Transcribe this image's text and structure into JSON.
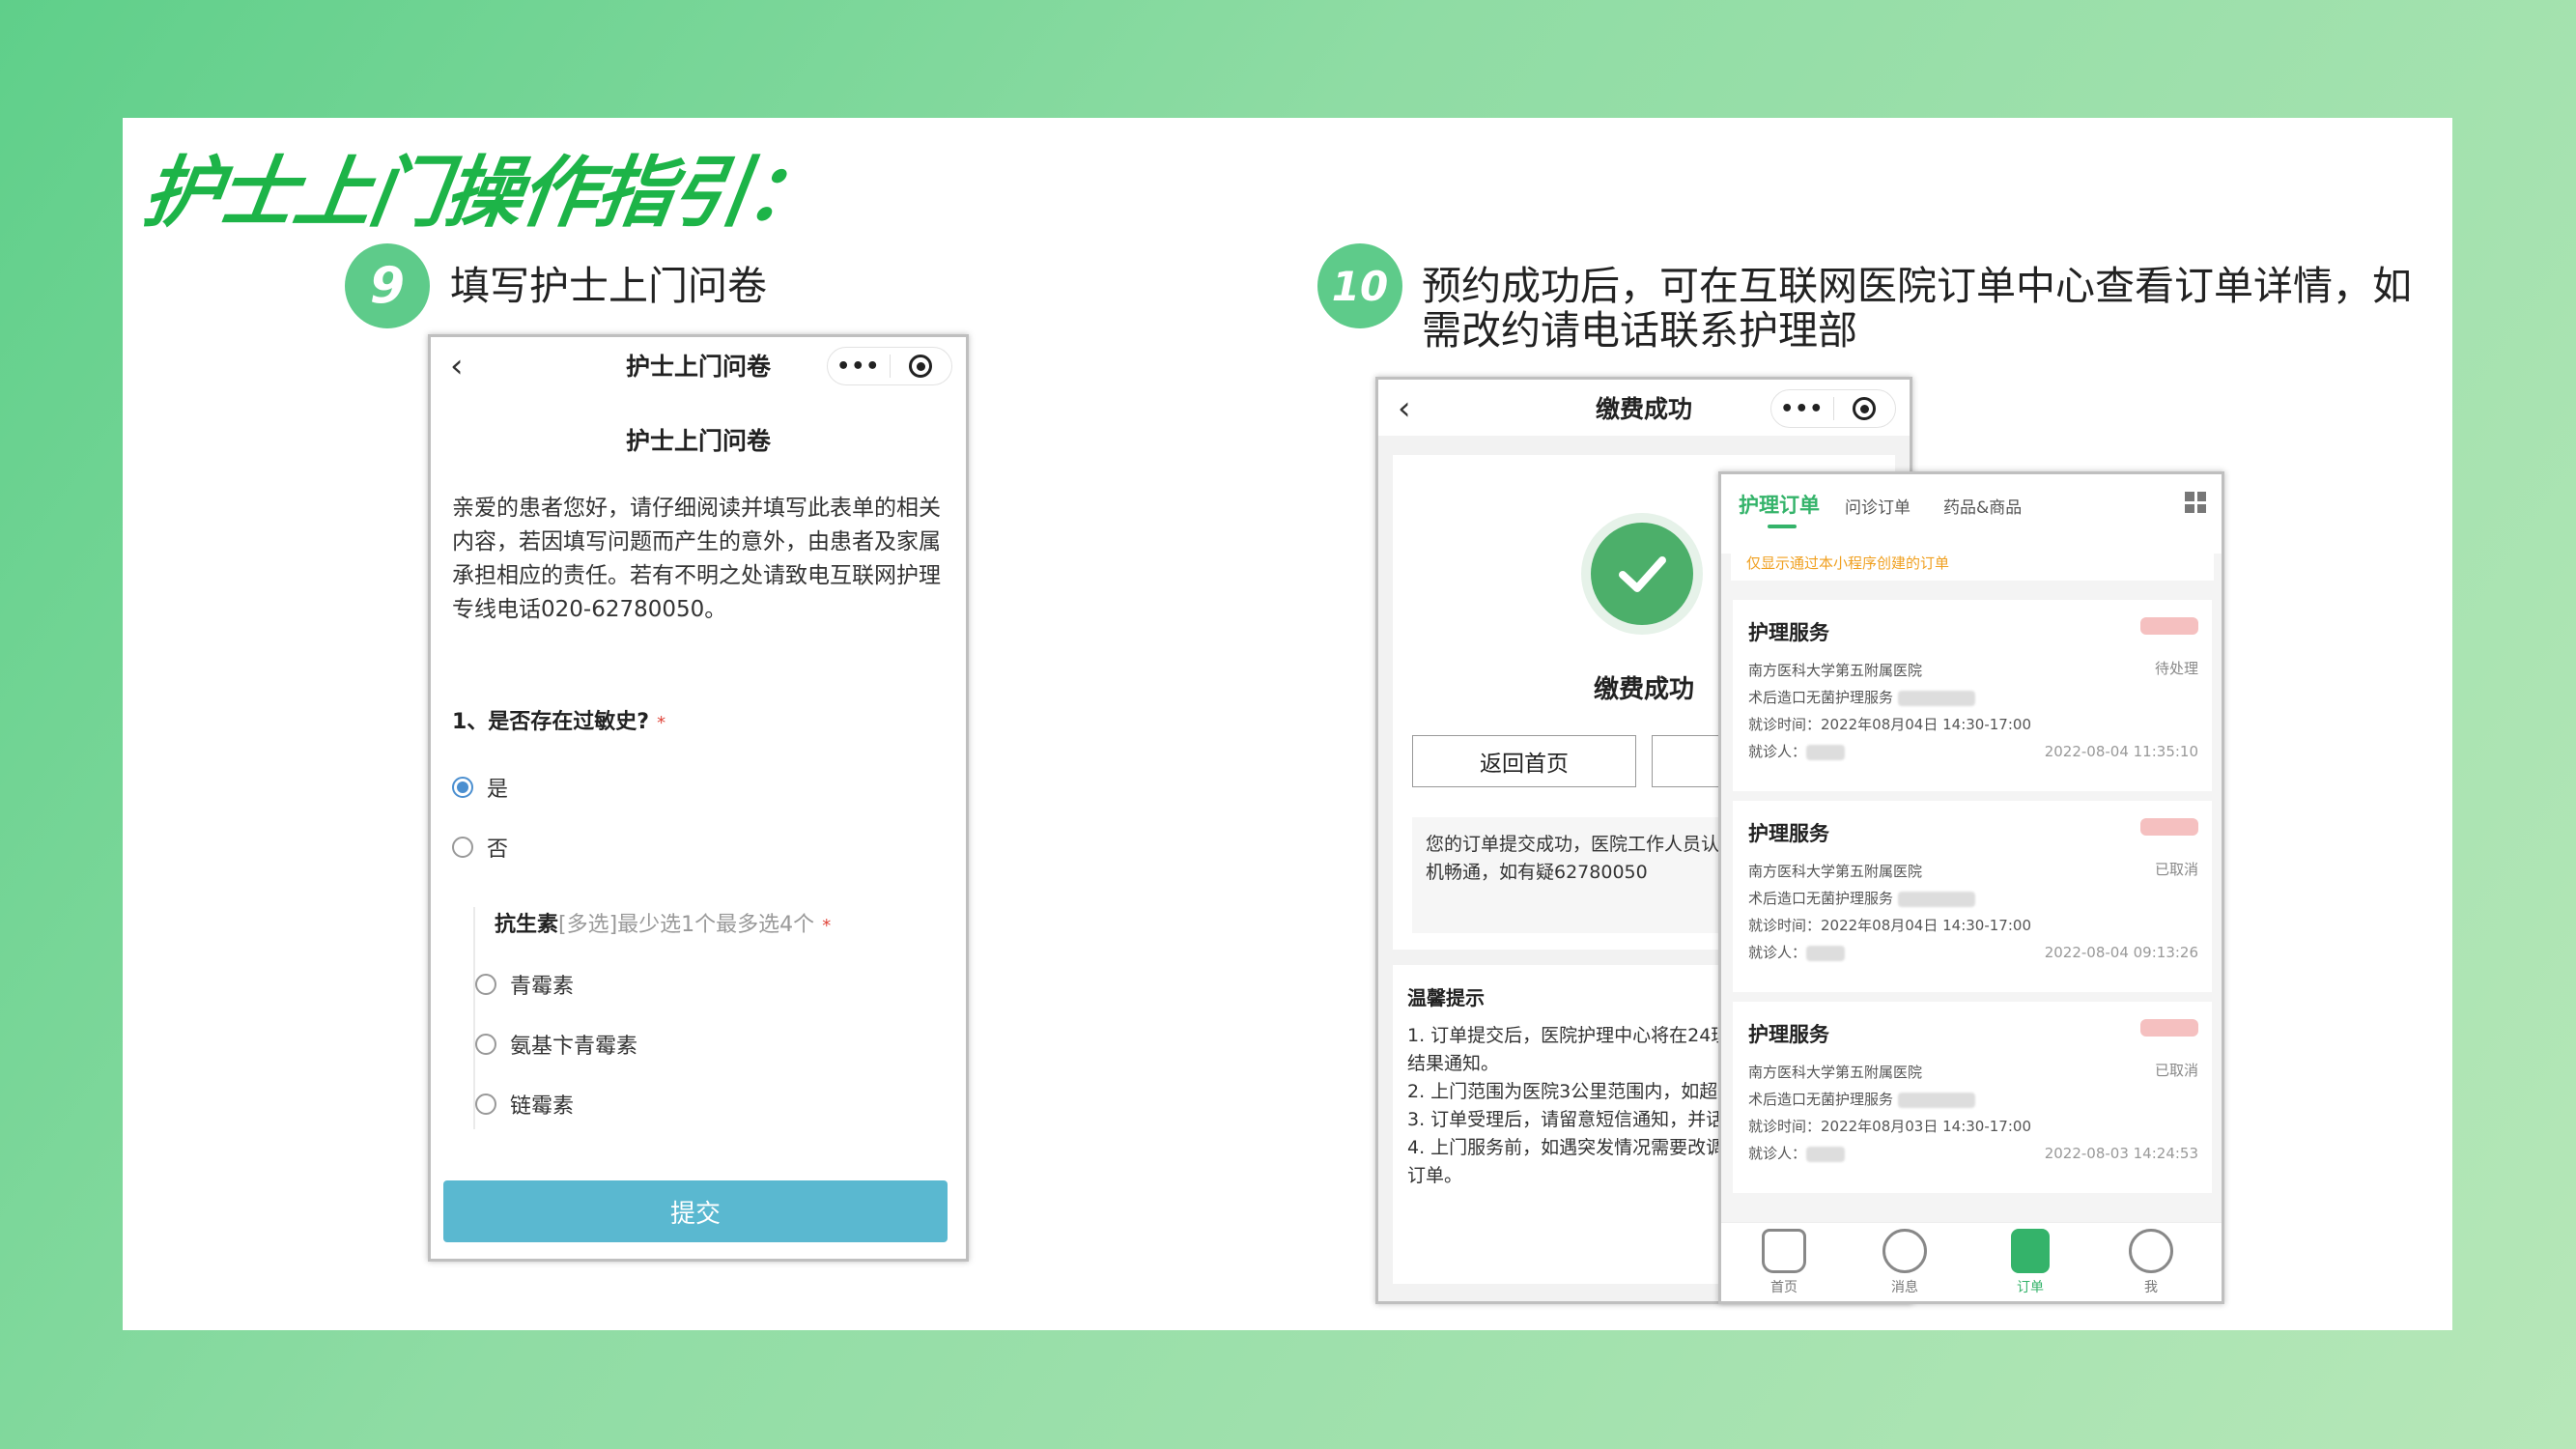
{
  "page": {
    "title": "护士上门操作指引："
  },
  "steps": [
    {
      "number": "9",
      "text": "填写护士上门问卷"
    },
    {
      "number": "10",
      "text_line1": "预约成功后，可在互联网医院订单中心查看订单详情，如",
      "text_line2": "需改约请电话联系护理部"
    }
  ],
  "questionnaire": {
    "navbar_title": "护士上门问卷",
    "back_glyph": "‹",
    "capsule_dots": "•••",
    "title": "护士上门问卷",
    "intro": "亲爱的患者您好，请仔细阅读并填写此表单的相关内容，若因填写问题而产生的意外，由患者及家属承担相应的责任。若有不明之处请致电互联网护理专线电话020-62780050。",
    "question1": "1、是否存在过敏史?",
    "required_mark": "*",
    "options": [
      "是",
      "否"
    ],
    "selected_option": "是",
    "sub_question_bold": "抗生素",
    "sub_question_hint": "[多选]最少选1个最多选4个",
    "sub_options": [
      "青霉素",
      "氨基卞青霉素",
      "链霉素"
    ],
    "submit_label": "提交"
  },
  "payment": {
    "navbar_title": "缴费成功",
    "back_glyph": "‹",
    "capsule_dots": "•••",
    "success_title": "缴费成功",
    "home_button": "返回首页",
    "notice": "您的订单提交成功，医院工作人员认信息，请保持手机畅通，如有疑62780050",
    "tips_title": "温馨提示",
    "tips": [
      "1. 订单提交后，医院护理中心将在24理，请关注医院接单结果通知。",
      "2. 上门范围为医院3公里范围内，如超能会被取消。",
      "3. 订单受理后，请留意短信通知，并话畅通。",
      "4. 上门服务前，如遇突发情况需要改调整上门时间或取消订单。"
    ]
  },
  "orders": {
    "tabs": [
      "护理订单",
      "问诊订单",
      "药品&商品"
    ],
    "active_tab": "护理订单",
    "note": "仅显示通过本小程序创建的订单",
    "cards": [
      {
        "title": "护理服务",
        "hospital": "南方医科大学第五附属医院",
        "status": "待处理",
        "service": "术后造口无菌护理服务",
        "visit_time": "就诊时间：2022年08月04日 14:30-17:00",
        "patient": "就诊人：",
        "created": "2022-08-04 11:35:10"
      },
      {
        "title": "护理服务",
        "hospital": "南方医科大学第五附属医院",
        "status": "已取消",
        "service": "术后造口无菌护理服务",
        "visit_time": "就诊时间：2022年08月04日 14:30-17:00",
        "patient": "就诊人：",
        "created": "2022-08-04 09:13:26"
      },
      {
        "title": "护理服务",
        "hospital": "南方医科大学第五附属医院",
        "status": "已取消",
        "service": "术后造口无菌护理服务",
        "visit_time": "就诊时间：2022年08月03日 14:30-17:00",
        "patient": "就诊人：",
        "created": "2022-08-03 14:24:53"
      }
    ],
    "bottom_nav": [
      "首页",
      "消息",
      "订单",
      "我"
    ],
    "active_nav": "订单"
  },
  "colors": {
    "title_green": "#1db448",
    "step_circle": "#5ecb8a",
    "submit_blue": "#5ab8d0",
    "success_green": "#4caf6a",
    "order_green": "#34b36a",
    "note_orange": "#f0a020"
  }
}
